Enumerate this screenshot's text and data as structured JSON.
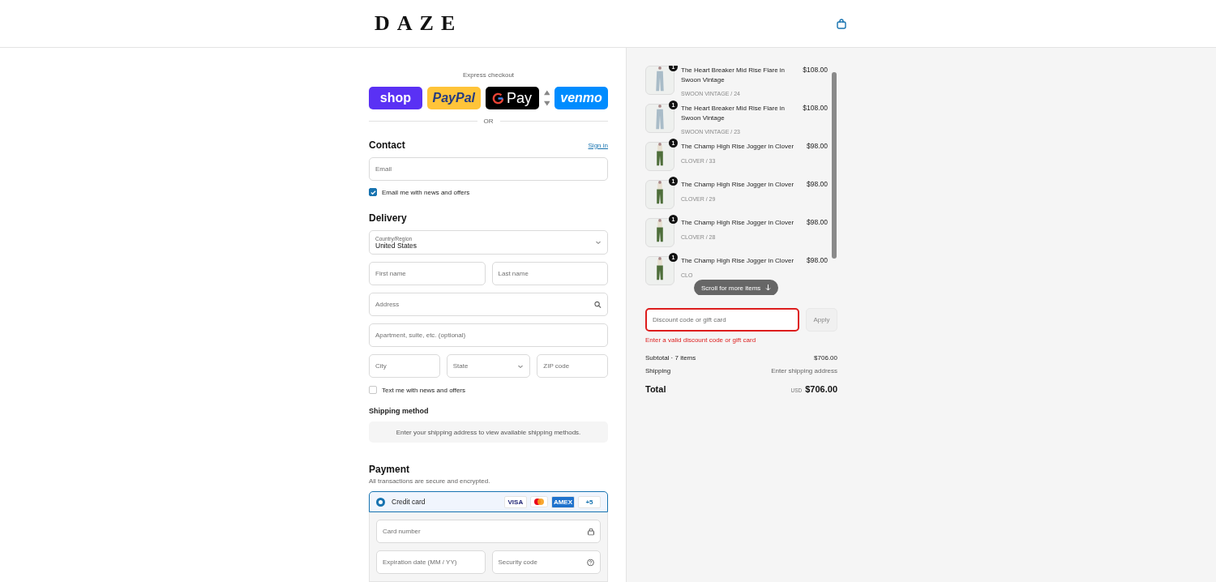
{
  "header": {
    "logo": "DAZE"
  },
  "express": {
    "title": "Express checkout",
    "buttons": [
      {
        "kind": "shop",
        "label": "shop"
      },
      {
        "kind": "paypal",
        "label": "PayPal"
      },
      {
        "kind": "gpay",
        "label": "Pay"
      },
      {
        "kind": "venmo",
        "label": "venmo"
      }
    ],
    "divider": "OR"
  },
  "contact": {
    "title": "Contact",
    "sign_in": "Sign in",
    "email": {
      "placeholder": "Email"
    },
    "news": {
      "label": "Email me with news and offers",
      "checked": true
    }
  },
  "delivery": {
    "title": "Delivery",
    "country": {
      "label": "Country/Region",
      "value": "United States"
    },
    "first_name": {
      "placeholder": "First name"
    },
    "last_name": {
      "placeholder": "Last name"
    },
    "address": {
      "placeholder": "Address"
    },
    "apartment": {
      "placeholder": "Apartment, suite, etc. (optional)"
    },
    "city": {
      "placeholder": "City"
    },
    "state": {
      "placeholder": "State"
    },
    "zip": {
      "placeholder": "ZIP code"
    },
    "sms": {
      "label": "Text me with news and offers",
      "checked": false
    }
  },
  "shipping": {
    "title": "Shipping method",
    "notice": "Enter your shipping address to view available shipping methods."
  },
  "payment": {
    "title": "Payment",
    "subtitle": "All transactions are secure and encrypted.",
    "method": {
      "label": "Credit card",
      "selected": true,
      "brands": [
        {
          "kind": "visa",
          "label": "VISA"
        },
        {
          "kind": "mastercard"
        },
        {
          "kind": "amex",
          "label": "AMEX"
        },
        {
          "kind": "more",
          "label": "+5"
        }
      ]
    },
    "card_number": {
      "placeholder": "Card number"
    },
    "expiry": {
      "placeholder": "Expiration date (MM / YY)"
    },
    "security": {
      "placeholder": "Security code"
    }
  },
  "cart": {
    "items": [
      {
        "quantity": "1",
        "title": "The Heart Breaker Mid Rise Flare in Swoon Vintage",
        "variant": "SWOON VINTAGE / 24",
        "price": "$108.00",
        "color": "#a9bcc8"
      },
      {
        "quantity": "1",
        "title": "The Heart Breaker Mid Rise Flare in Swoon Vintage",
        "variant": "SWOON VINTAGE / 23",
        "price": "$108.00",
        "color": "#a9bcc8"
      },
      {
        "quantity": "1",
        "title": "The Champ High Rise Jogger in Clover",
        "variant": "CLOVER / 33",
        "price": "$98.00",
        "color": "#4e6e3a"
      },
      {
        "quantity": "1",
        "title": "The Champ High Rise Jogger in Clover",
        "variant": "CLOVER / 29",
        "price": "$98.00",
        "color": "#4e6e3a"
      },
      {
        "quantity": "1",
        "title": "The Champ High Rise Jogger in Clover",
        "variant": "CLOVER / 28",
        "price": "$98.00",
        "color": "#4e6e3a"
      },
      {
        "quantity": "1",
        "title": "The Champ High Rise Jogger in Clover",
        "variant": "CLO",
        "price": "$98.00",
        "color": "#4e6e3a"
      }
    ],
    "scroll_hint": "Scroll for more items",
    "discount": {
      "placeholder": "Discount code or gift card",
      "error": true,
      "error_text": "Enter a valid discount code or gift card",
      "apply": "Apply"
    },
    "subtotal": {
      "label": "Subtotal · 7 items",
      "value": "$706.00"
    },
    "shipping": {
      "label": "Shipping",
      "value": "Enter shipping address"
    },
    "total": {
      "label": "Total",
      "currency": "USD",
      "value": "$706.00"
    }
  }
}
